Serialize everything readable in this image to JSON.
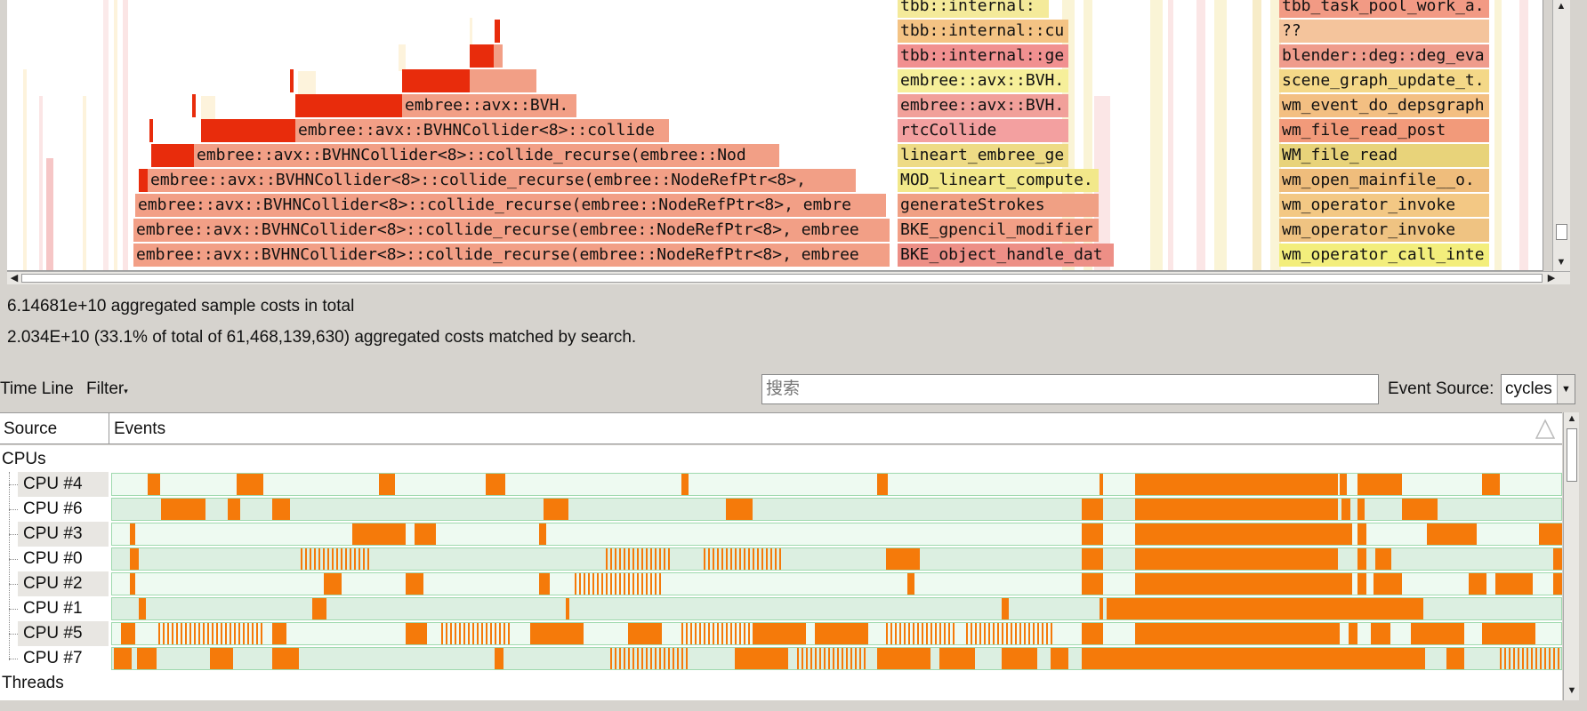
{
  "flamegraph": {
    "frames": [
      {
        "label": "embree::avx::BVHNCollider<8>::collide_recurse(embree::NodeRefPtr<8>, embree",
        "color": "#f29f86"
      },
      {
        "label": "embree::avx::BVHNCollider<8>::collide_recurse(embree::NodeRefPtr<8>, embree",
        "color": "#f29f86"
      },
      {
        "label": "embree::avx::BVHNCollider<8>::collide_recurse(embree::NodeRefPtr<8>, embre",
        "color": "#f29f86"
      },
      {
        "label": "embree::avx::BVHNCollider<8>::collide_recurse(embree::NodeRefPtr<8>,",
        "color": "#f29f86"
      },
      {
        "label": "embree::avx::BVHNCollider<8>::collide_recurse(embree::Nod",
        "color": "#f29f86"
      },
      {
        "label": "embree::avx::BVHNCollider<8>::collide",
        "color": "#f29f86"
      },
      {
        "label": "embree::avx::BVH.",
        "color": "#f29f86"
      },
      {
        "label": "BKE_object_handle_dat",
        "color": "#ed8f86"
      },
      {
        "label": "BKE_gpencil_modifier",
        "color": "#f29f86"
      },
      {
        "label": "generateStrokes",
        "color": "#f0a084"
      },
      {
        "label": "MOD_lineart_compute.",
        "color": "#f2e88a"
      },
      {
        "label": "lineart_embree_ge",
        "color": "#eedb85"
      },
      {
        "label": "rtcCollide",
        "color": "#f3a0a0"
      },
      {
        "label": "embree::avx::BVH.",
        "color": "#f1a09a"
      },
      {
        "label": "embree::avx::BVH.",
        "color": "#f6ef9a"
      },
      {
        "label": "tbb::internal::ge",
        "color": "#f19090"
      },
      {
        "label": "tbb::internal::cu",
        "color": "#f4c384"
      },
      {
        "label": "tbb::internal:",
        "color": "#f4ea9a"
      },
      {
        "label": "wm_operator_call_inte",
        "color": "#f3ee7c"
      },
      {
        "label": "wm_operator_invoke",
        "color": "#efc382"
      },
      {
        "label": "wm_operator_invoke",
        "color": "#f3c884"
      },
      {
        "label": "wm_open_mainfile__o.",
        "color": "#efbd7c"
      },
      {
        "label": "WM_file_read",
        "color": "#e8d37a"
      },
      {
        "label": "wm_file_read_post",
        "color": "#f29a7a"
      },
      {
        "label": "wm_event_do_depsgraph",
        "color": "#f3bf82"
      },
      {
        "label": "scene_graph_update_t.",
        "color": "#f4d888"
      },
      {
        "label": "blender::deg::deg_eva",
        "color": "#ef9c8c"
      },
      {
        "label": "??",
        "color": "#f4c49c"
      },
      {
        "label": "tbb_task_pool_work_a.",
        "color": "#f29a84"
      }
    ]
  },
  "stats": {
    "total_line": "6.14681e+10 aggregated sample costs in total",
    "search_line": "2.034E+10 (33.1% of total of 61,468,139,630) aggregated costs matched by search."
  },
  "toolbar": {
    "timeline_tab": "Time Line",
    "filter_label": "Filter",
    "search_placeholder": "搜索",
    "event_source_label": "Event Source:",
    "event_source_value": "cycles"
  },
  "timeline": {
    "columns": {
      "source": "Source",
      "events": "Events"
    },
    "groups": {
      "cpus": "CPUs",
      "threads": "Threads"
    },
    "rows": [
      {
        "label": "CPU #4"
      },
      {
        "label": "CPU #6"
      },
      {
        "label": "CPU #3"
      },
      {
        "label": "CPU #0"
      },
      {
        "label": "CPU #2"
      },
      {
        "label": "CPU #1"
      },
      {
        "label": "CPU #5"
      },
      {
        "label": "CPU #7"
      }
    ]
  },
  "colors": {
    "event_bar": "#f57a0a",
    "track_light": "#eefaf1",
    "track_dark": "#dcefe1",
    "hot_frame": "#e82c0c"
  }
}
